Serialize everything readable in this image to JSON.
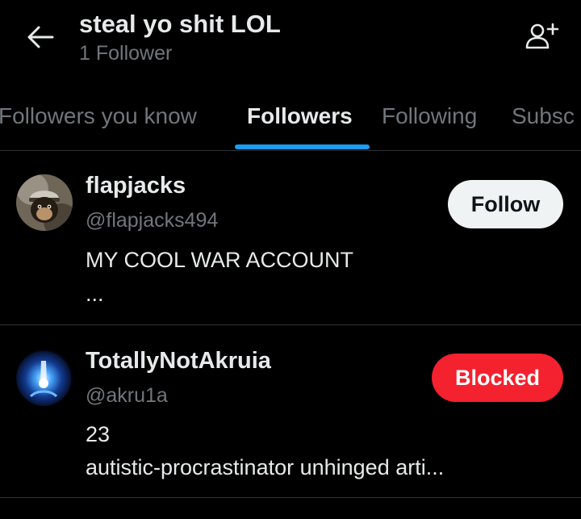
{
  "header": {
    "title": "steal yo shit LOL",
    "subtitle": "1 Follower",
    "back_icon": "arrow-left-icon",
    "add_user_icon": "person-add-icon"
  },
  "tabs": [
    {
      "label": "Followers you know",
      "active": false
    },
    {
      "label": "Followers",
      "active": true
    },
    {
      "label": "Following",
      "active": false
    },
    {
      "label": "Subsc",
      "active": false
    }
  ],
  "users": [
    {
      "name": "flapjacks",
      "handle": "@flapjacks494",
      "bio_line1": "MY COOL WAR ACCOUNT",
      "bio_line2": "...",
      "button": "Follow"
    },
    {
      "name": "TotallyNotAkruia",
      "handle": "@akru1a",
      "bio_line1": "23",
      "bio_line2": "autistic-procrastinator unhinged arti...",
      "button": "Blocked"
    }
  ],
  "colors": {
    "background": "#000000",
    "accent": "#1d9bf0",
    "blocked": "#f4212e",
    "muted_text": "#71767b"
  }
}
